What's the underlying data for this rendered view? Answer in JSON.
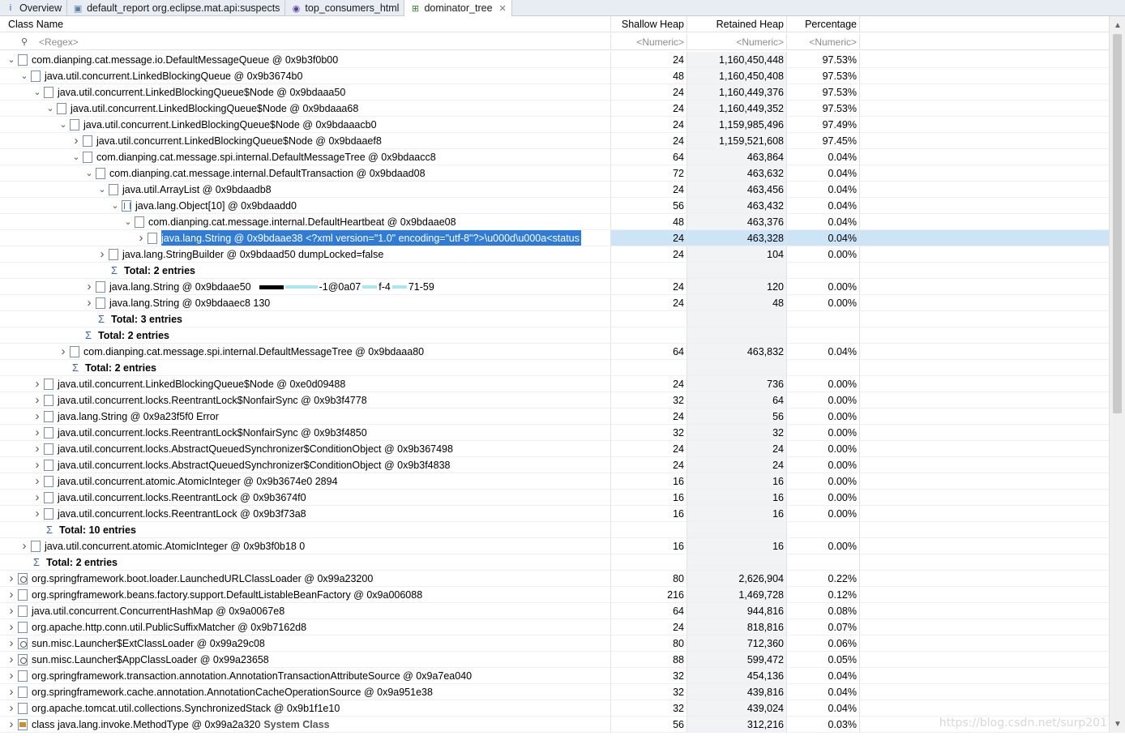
{
  "tabs": [
    {
      "label": "Overview",
      "icon": "info-icon"
    },
    {
      "label": "default_report  org.eclipse.mat.api:suspects",
      "icon": "report-icon"
    },
    {
      "label": "top_consumers_html",
      "icon": "globe-icon"
    },
    {
      "label": "dominator_tree",
      "icon": "tree-icon",
      "active": true
    }
  ],
  "columns": {
    "class_name": "Class Name",
    "shallow_heap": "Shallow Heap",
    "retained_heap": "Retained Heap",
    "percentage": "Percentage"
  },
  "filters": {
    "class_name": "<Regex>",
    "shallow_heap": "<Numeric>",
    "retained_heap": "<Numeric>",
    "percentage": "<Numeric>"
  },
  "rows": [
    {
      "level": 0,
      "tw": "v",
      "icon": "obj",
      "name": "com.dianping.cat.message.io.DefaultMessageQueue @ 0x9b3f0b00",
      "shallow": "24",
      "retained": "1,160,450,448",
      "pct": "97.53%"
    },
    {
      "level": 1,
      "tw": "v",
      "icon": "obj",
      "name": "java.util.concurrent.LinkedBlockingQueue @ 0x9b3674b0",
      "shallow": "48",
      "retained": "1,160,450,408",
      "pct": "97.53%"
    },
    {
      "level": 2,
      "tw": "v",
      "icon": "obj",
      "name": "java.util.concurrent.LinkedBlockingQueue$Node @ 0x9bdaaa50",
      "shallow": "24",
      "retained": "1,160,449,376",
      "pct": "97.53%"
    },
    {
      "level": 3,
      "tw": "v",
      "icon": "obj",
      "name": "java.util.concurrent.LinkedBlockingQueue$Node @ 0x9bdaaa68",
      "shallow": "24",
      "retained": "1,160,449,352",
      "pct": "97.53%"
    },
    {
      "level": 4,
      "tw": "v",
      "icon": "obj",
      "name": "java.util.concurrent.LinkedBlockingQueue$Node @ 0x9bdaaacb0",
      "shallow": "24",
      "retained": "1,159,985,496",
      "pct": "97.49%"
    },
    {
      "level": 5,
      "tw": ">",
      "icon": "obj",
      "name": "java.util.concurrent.LinkedBlockingQueue$Node @ 0x9bdaaef8",
      "shallow": "24",
      "retained": "1,159,521,608",
      "pct": "97.45%"
    },
    {
      "level": 5,
      "tw": "v",
      "icon": "obj",
      "name": "com.dianping.cat.message.spi.internal.DefaultMessageTree @ 0x9bdaacc8",
      "shallow": "64",
      "retained": "463,864",
      "pct": "0.04%"
    },
    {
      "level": 6,
      "tw": "v",
      "icon": "obj",
      "name": "com.dianping.cat.message.internal.DefaultTransaction @ 0x9bdaad08",
      "shallow": "72",
      "retained": "463,632",
      "pct": "0.04%"
    },
    {
      "level": 7,
      "tw": "v",
      "icon": "obj",
      "name": "java.util.ArrayList @ 0x9bdaadb8",
      "shallow": "24",
      "retained": "463,456",
      "pct": "0.04%"
    },
    {
      "level": 8,
      "tw": "v",
      "icon": "arr",
      "name": "java.lang.Object[10] @ 0x9bdaadd0",
      "shallow": "56",
      "retained": "463,432",
      "pct": "0.04%"
    },
    {
      "level": 9,
      "tw": "v",
      "icon": "obj",
      "name": "com.dianping.cat.message.internal.DefaultHeartbeat @ 0x9bdaae08",
      "shallow": "48",
      "retained": "463,376",
      "pct": "0.04%"
    },
    {
      "level": 10,
      "tw": ">",
      "icon": "obj",
      "name": "java.lang.String @ 0x9bdaae38  <?xml version=\"1.0\" encoding=\"utf-8\"?>\\u000d\\u000a<status",
      "shallow": "24",
      "retained": "463,328",
      "pct": "0.04%",
      "selected": true
    },
    {
      "level": 7,
      "tw": ">",
      "icon": "obj",
      "name": "java.lang.StringBuilder @ 0x9bdaad50  dumpLocked=false",
      "shallow": "24",
      "retained": "104",
      "pct": "0.00%"
    },
    {
      "level": 8,
      "total": true,
      "name": "Total: 2 entries"
    },
    {
      "level": 6,
      "tw": ">",
      "icon": "obj",
      "name": "java.lang.String @ 0x9bdaae50",
      "shallow": "24",
      "retained": "120",
      "pct": "0.00%",
      "redacted": true,
      "tail": "-1@0a07",
      "tail2": "f-4",
      "tail3": "71-59"
    },
    {
      "level": 6,
      "tw": ">",
      "icon": "obj",
      "name": "java.lang.String @ 0x9bdaaec8  130",
      "shallow": "24",
      "retained": "48",
      "pct": "0.00%"
    },
    {
      "level": 7,
      "total": true,
      "name": "Total: 3 entries"
    },
    {
      "level": 6,
      "total": true,
      "name": "Total: 2 entries"
    },
    {
      "level": 4,
      "tw": ">",
      "icon": "obj",
      "name": "com.dianping.cat.message.spi.internal.DefaultMessageTree @ 0x9bdaaa80",
      "shallow": "64",
      "retained": "463,832",
      "pct": "0.04%"
    },
    {
      "level": 5,
      "total": true,
      "name": "Total: 2 entries"
    },
    {
      "level": 2,
      "tw": ">",
      "icon": "obj",
      "name": "java.util.concurrent.LinkedBlockingQueue$Node @ 0xe0d09488",
      "shallow": "24",
      "retained": "736",
      "pct": "0.00%"
    },
    {
      "level": 2,
      "tw": ">",
      "icon": "obj",
      "name": "java.util.concurrent.locks.ReentrantLock$NonfairSync @ 0x9b3f4778",
      "shallow": "32",
      "retained": "64",
      "pct": "0.00%"
    },
    {
      "level": 2,
      "tw": ">",
      "icon": "obj",
      "name": "java.lang.String @ 0x9a23f5f0  Error",
      "shallow": "24",
      "retained": "56",
      "pct": "0.00%"
    },
    {
      "level": 2,
      "tw": ">",
      "icon": "obj",
      "name": "java.util.concurrent.locks.ReentrantLock$NonfairSync @ 0x9b3f4850",
      "shallow": "32",
      "retained": "32",
      "pct": "0.00%"
    },
    {
      "level": 2,
      "tw": ">",
      "icon": "obj",
      "name": "java.util.concurrent.locks.AbstractQueuedSynchronizer$ConditionObject @ 0x9b367498",
      "shallow": "24",
      "retained": "24",
      "pct": "0.00%"
    },
    {
      "level": 2,
      "tw": ">",
      "icon": "obj",
      "name": "java.util.concurrent.locks.AbstractQueuedSynchronizer$ConditionObject @ 0x9b3f4838",
      "shallow": "24",
      "retained": "24",
      "pct": "0.00%"
    },
    {
      "level": 2,
      "tw": ">",
      "icon": "obj",
      "name": "java.util.concurrent.atomic.AtomicInteger @ 0x9b3674e0  2894",
      "shallow": "16",
      "retained": "16",
      "pct": "0.00%"
    },
    {
      "level": 2,
      "tw": ">",
      "icon": "obj",
      "name": "java.util.concurrent.locks.ReentrantLock @ 0x9b3674f0",
      "shallow": "16",
      "retained": "16",
      "pct": "0.00%"
    },
    {
      "level": 2,
      "tw": ">",
      "icon": "obj",
      "name": "java.util.concurrent.locks.ReentrantLock @ 0x9b3f73a8",
      "shallow": "16",
      "retained": "16",
      "pct": "0.00%"
    },
    {
      "level": 3,
      "total": true,
      "name": "Total: 10 entries"
    },
    {
      "level": 1,
      "tw": ">",
      "icon": "obj",
      "name": "java.util.concurrent.atomic.AtomicInteger @ 0x9b3f0b18  0",
      "shallow": "16",
      "retained": "16",
      "pct": "0.00%"
    },
    {
      "level": 2,
      "total": true,
      "name": "Total: 2 entries"
    },
    {
      "level": 0,
      "tw": ">",
      "icon": "cl",
      "name": "org.springframework.boot.loader.LaunchedURLClassLoader @ 0x99a23200",
      "shallow": "80",
      "retained": "2,626,904",
      "pct": "0.22%"
    },
    {
      "level": 0,
      "tw": ">",
      "icon": "obj",
      "name": "org.springframework.beans.factory.support.DefaultListableBeanFactory @ 0x9a006088",
      "shallow": "216",
      "retained": "1,469,728",
      "pct": "0.12%"
    },
    {
      "level": 0,
      "tw": ">",
      "icon": "obj",
      "name": "java.util.concurrent.ConcurrentHashMap @ 0x9a0067e8",
      "shallow": "64",
      "retained": "944,816",
      "pct": "0.08%"
    },
    {
      "level": 0,
      "tw": ">",
      "icon": "obj",
      "name": "org.apache.http.conn.util.PublicSuffixMatcher @ 0x9b7162d8",
      "shallow": "24",
      "retained": "818,816",
      "pct": "0.07%"
    },
    {
      "level": 0,
      "tw": ">",
      "icon": "cl",
      "name": "sun.misc.Launcher$ExtClassLoader @ 0x99a29c08",
      "shallow": "80",
      "retained": "712,360",
      "pct": "0.06%"
    },
    {
      "level": 0,
      "tw": ">",
      "icon": "cl",
      "name": "sun.misc.Launcher$AppClassLoader @ 0x99a23658",
      "shallow": "88",
      "retained": "599,472",
      "pct": "0.05%"
    },
    {
      "level": 0,
      "tw": ">",
      "icon": "obj",
      "name": "org.springframework.transaction.annotation.AnnotationTransactionAttributeSource @ 0x9a7ea040",
      "shallow": "32",
      "retained": "454,136",
      "pct": "0.04%"
    },
    {
      "level": 0,
      "tw": ">",
      "icon": "obj",
      "name": "org.springframework.cache.annotation.AnnotationCacheOperationSource @ 0x9a951e38",
      "shallow": "32",
      "retained": "439,816",
      "pct": "0.04%"
    },
    {
      "level": 0,
      "tw": ">",
      "icon": "obj",
      "name": "org.apache.tomcat.util.collections.SynchronizedStack @ 0x9b1f1e10",
      "shallow": "32",
      "retained": "439,024",
      "pct": "0.04%"
    },
    {
      "level": 0,
      "tw": ">",
      "icon": "sc",
      "name": "class java.lang.invoke.MethodType @ 0x99a2a320",
      "sys": "System Class",
      "shallow": "56",
      "retained": "312,216",
      "pct": "0.03%"
    }
  ],
  "watermark": "https://blog.csdn.net/surp201"
}
